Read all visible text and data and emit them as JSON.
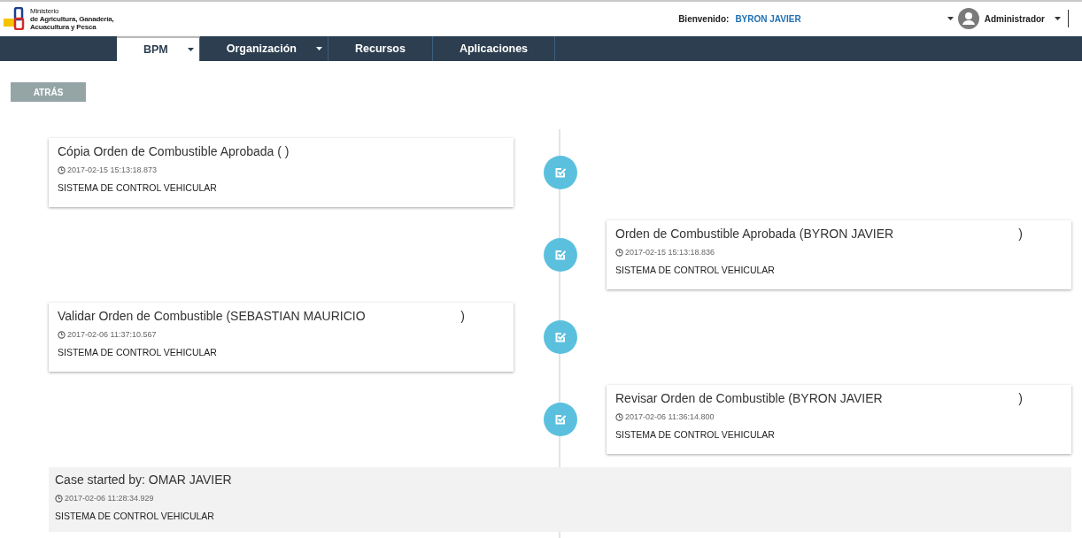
{
  "header": {
    "logo_lines": [
      "Ministerio",
      "de Agricultura, Ganadería,",
      "Acuacultura y Pesca"
    ],
    "welcome_label": "Bienvenido:",
    "user_name": "BYRON JAVIER",
    "role": "Administrador"
  },
  "nav": {
    "tabs": [
      {
        "label": "BPM",
        "selected": true,
        "dropdown": true
      },
      {
        "label": "Organización",
        "selected": false,
        "dropdown": true
      },
      {
        "label": "Recursos",
        "selected": false,
        "dropdown": false
      },
      {
        "label": "Aplicaciones",
        "selected": false,
        "dropdown": false
      }
    ]
  },
  "back_button": "ATRÁS",
  "timeline": [
    {
      "title": "Cópia Orden de Combustible Aprobada ( )",
      "timestamp": "2017-02-15 15:13:18.873",
      "system": "SISTEMA DE CONTROL VEHICULAR"
    },
    {
      "title": "Orden de Combustible Aprobada (BYRON JAVIER",
      "closing": ")",
      "timestamp": "2017-02-15 15:13:18.836",
      "system": "SISTEMA DE CONTROL VEHICULAR"
    },
    {
      "title": "Validar Orden de Combustible (SEBASTIAN MAURICIO",
      "closing": ")",
      "timestamp": "2017-02-06 11:37:10.567",
      "system": "SISTEMA DE CONTROL VEHICULAR"
    },
    {
      "title": "Revisar Orden de Combustible (BYRON JAVIER",
      "closing": ")",
      "timestamp": "2017-02-06 11:36:14.800",
      "system": "SISTEMA DE CONTROL VEHICULAR"
    }
  ],
  "case_start": {
    "title": "Case started by: OMAR JAVIER",
    "timestamp": "2017-02-06 11:28:34.929",
    "system": "SISTEMA DE CONTROL VEHICULAR"
  }
}
